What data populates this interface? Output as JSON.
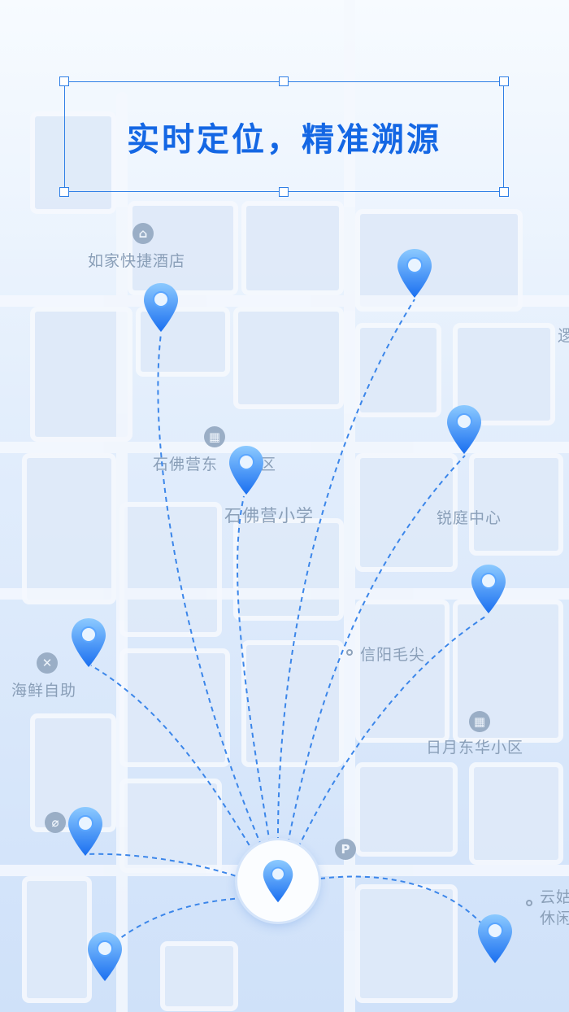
{
  "header": {
    "title": "实时定位，精准溯源"
  },
  "map": {
    "labels": {
      "hotel": "如家快捷酒店",
      "community_sfy_east": "石佛营东",
      "community_suffix": "区",
      "school": "石佛营小学",
      "ruiting": "锐庭中心",
      "xinyang": "信阳毛尖",
      "seafood": "海鲜自助",
      "riyue": "日月东华小区",
      "yun_line1": "云姑",
      "yun_line2": "休闲",
      "edge_char": "逻"
    },
    "icons": {
      "hotel": "bed-icon",
      "community": "building-icon",
      "restaurant": "fork-knife-icon",
      "parking": "parking-icon",
      "parking_glyph": "P"
    }
  },
  "colors": {
    "accent": "#1467e4",
    "pin_gradient_top": "#7cc0ff",
    "pin_gradient_bottom": "#1a6ff0",
    "route_line": "#3b86ea"
  }
}
